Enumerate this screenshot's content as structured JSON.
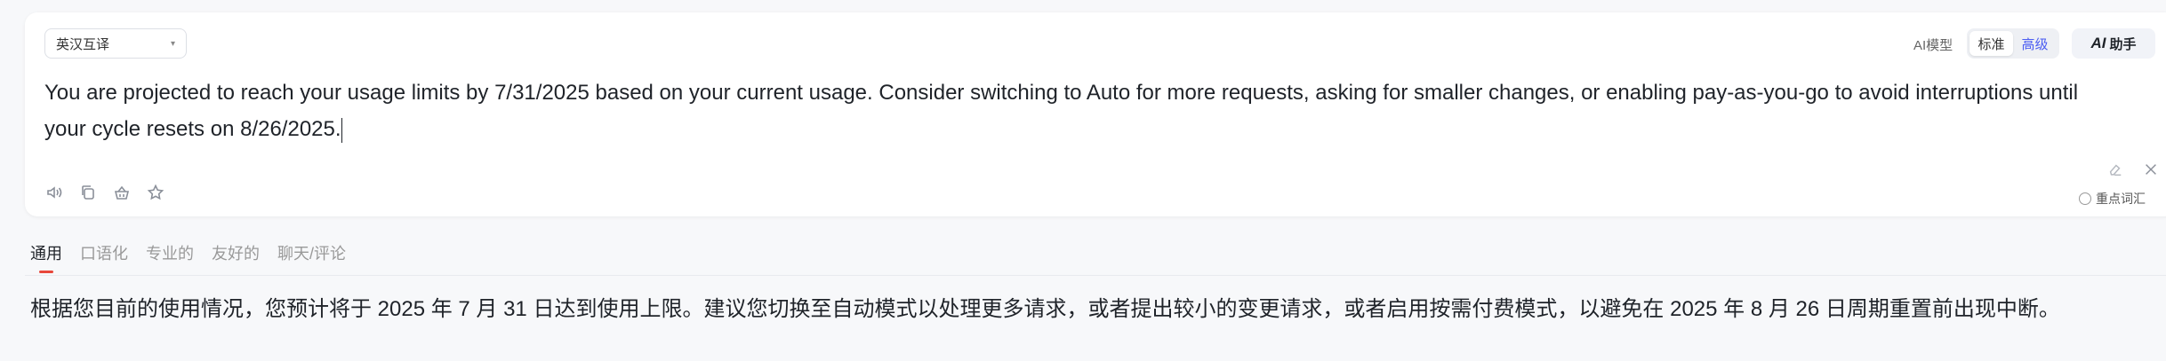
{
  "toolbar": {
    "language_mode": "英汉互译",
    "model_label": "AI模型",
    "model_options": [
      "标准",
      "高级"
    ],
    "assistant_ai": "AI",
    "assistant_label": "助手"
  },
  "source": {
    "text": "You are projected to reach your usage limits by 7/31/2025 based on your current usage. Consider switching to Auto for more requests, asking for smaller changes, or enabling pay-as-you-go to avoid interruptions until your cycle resets on 8/26/2025."
  },
  "options": {
    "keyword_label": "重点词汇"
  },
  "tabs": [
    {
      "label": "通用",
      "active": true
    },
    {
      "label": "口语化"
    },
    {
      "label": "专业的"
    },
    {
      "label": "友好的"
    },
    {
      "label": "聊天/评论"
    }
  ],
  "result": {
    "text": "根据您目前的使用情况，您预计将于 2025 年 7 月 31 日达到使用上限。建议您切换至自动模式以处理更多请求，或者提出较小的变更请求，或者启用按需付费模式，以避免在 2025 年 8 月 26 日周期重置前出现中断。"
  },
  "colors": {
    "accent_blue": "#4a5cf2",
    "tab_underline": "#e8473a"
  },
  "icons": [
    "speaker-icon",
    "copy-icon",
    "basket-icon",
    "star-icon",
    "eraser-icon",
    "close-icon",
    "search-icon"
  ]
}
